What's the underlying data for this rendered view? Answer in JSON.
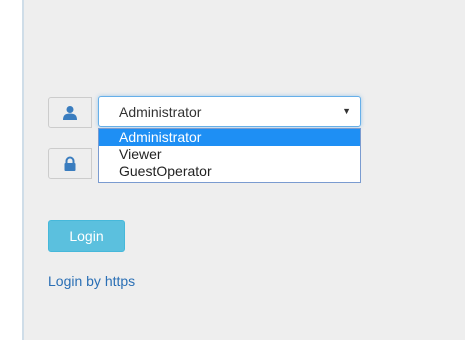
{
  "login_form": {
    "user_select": {
      "selected_value": "Administrator",
      "options": [
        "Administrator",
        "Viewer",
        "GuestOperator"
      ]
    },
    "login_button_label": "Login",
    "https_link_label": "Login by https"
  },
  "colors": {
    "panel_bg": "#eeeeee",
    "button_bg": "#5bc0de",
    "option_highlight": "#1e8ff4",
    "link": "#2a6fb5"
  },
  "icons": {
    "user_addon": "user-icon",
    "password_addon": "lock-icon",
    "select_arrow": "caret-down-icon"
  }
}
